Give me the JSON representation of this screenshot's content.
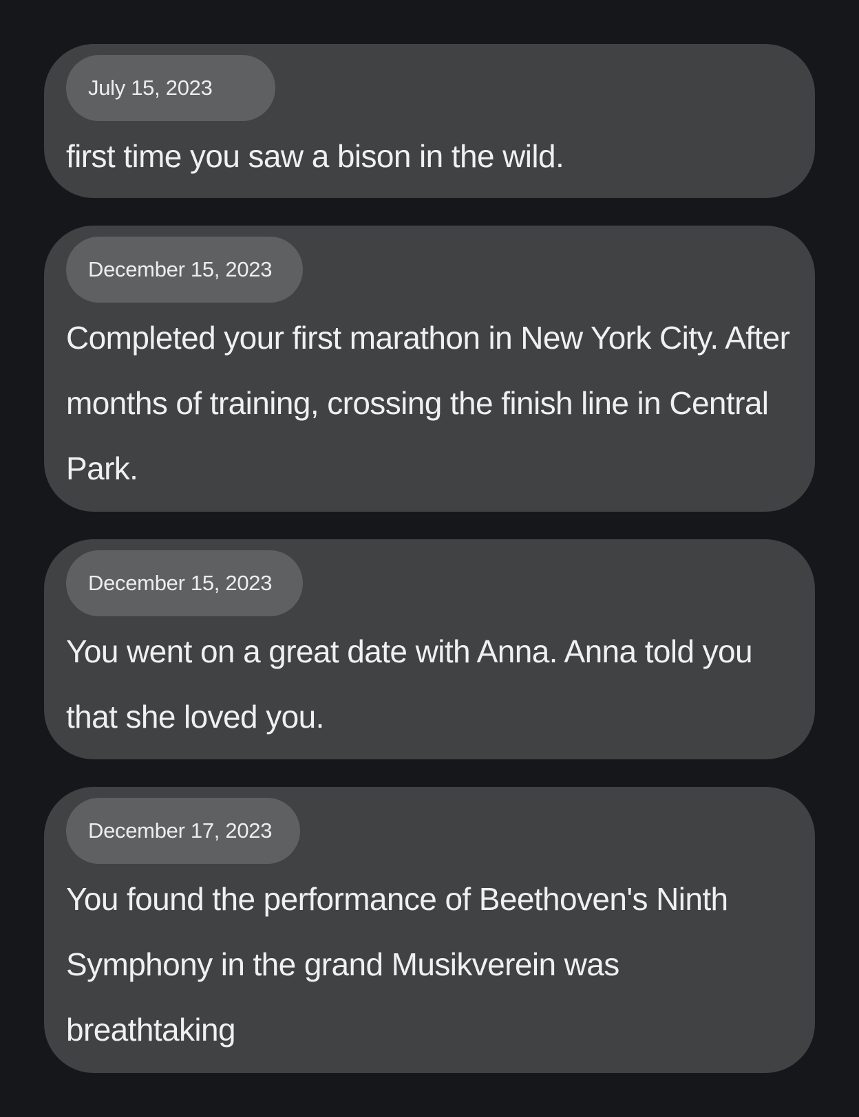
{
  "memories": [
    {
      "date": "July 15, 2023",
      "text": "first time you saw a bison in the wild."
    },
    {
      "date": "December 15, 2023",
      "text": "Completed your first marathon in New York City. After months of training, crossing the finish line in Central Park."
    },
    {
      "date": "December 15, 2023",
      "text": "You went on a great date with Anna. Anna told you that she loved you."
    },
    {
      "date": "December 17, 2023",
      "text": "You found the performance of Beethoven's Ninth Symphony in the grand Musikverein was breathtaking"
    }
  ],
  "colors": {
    "background": "#16171b",
    "card": "#414244",
    "date_pill": "#5f6062",
    "text": "#f0f0f0"
  }
}
